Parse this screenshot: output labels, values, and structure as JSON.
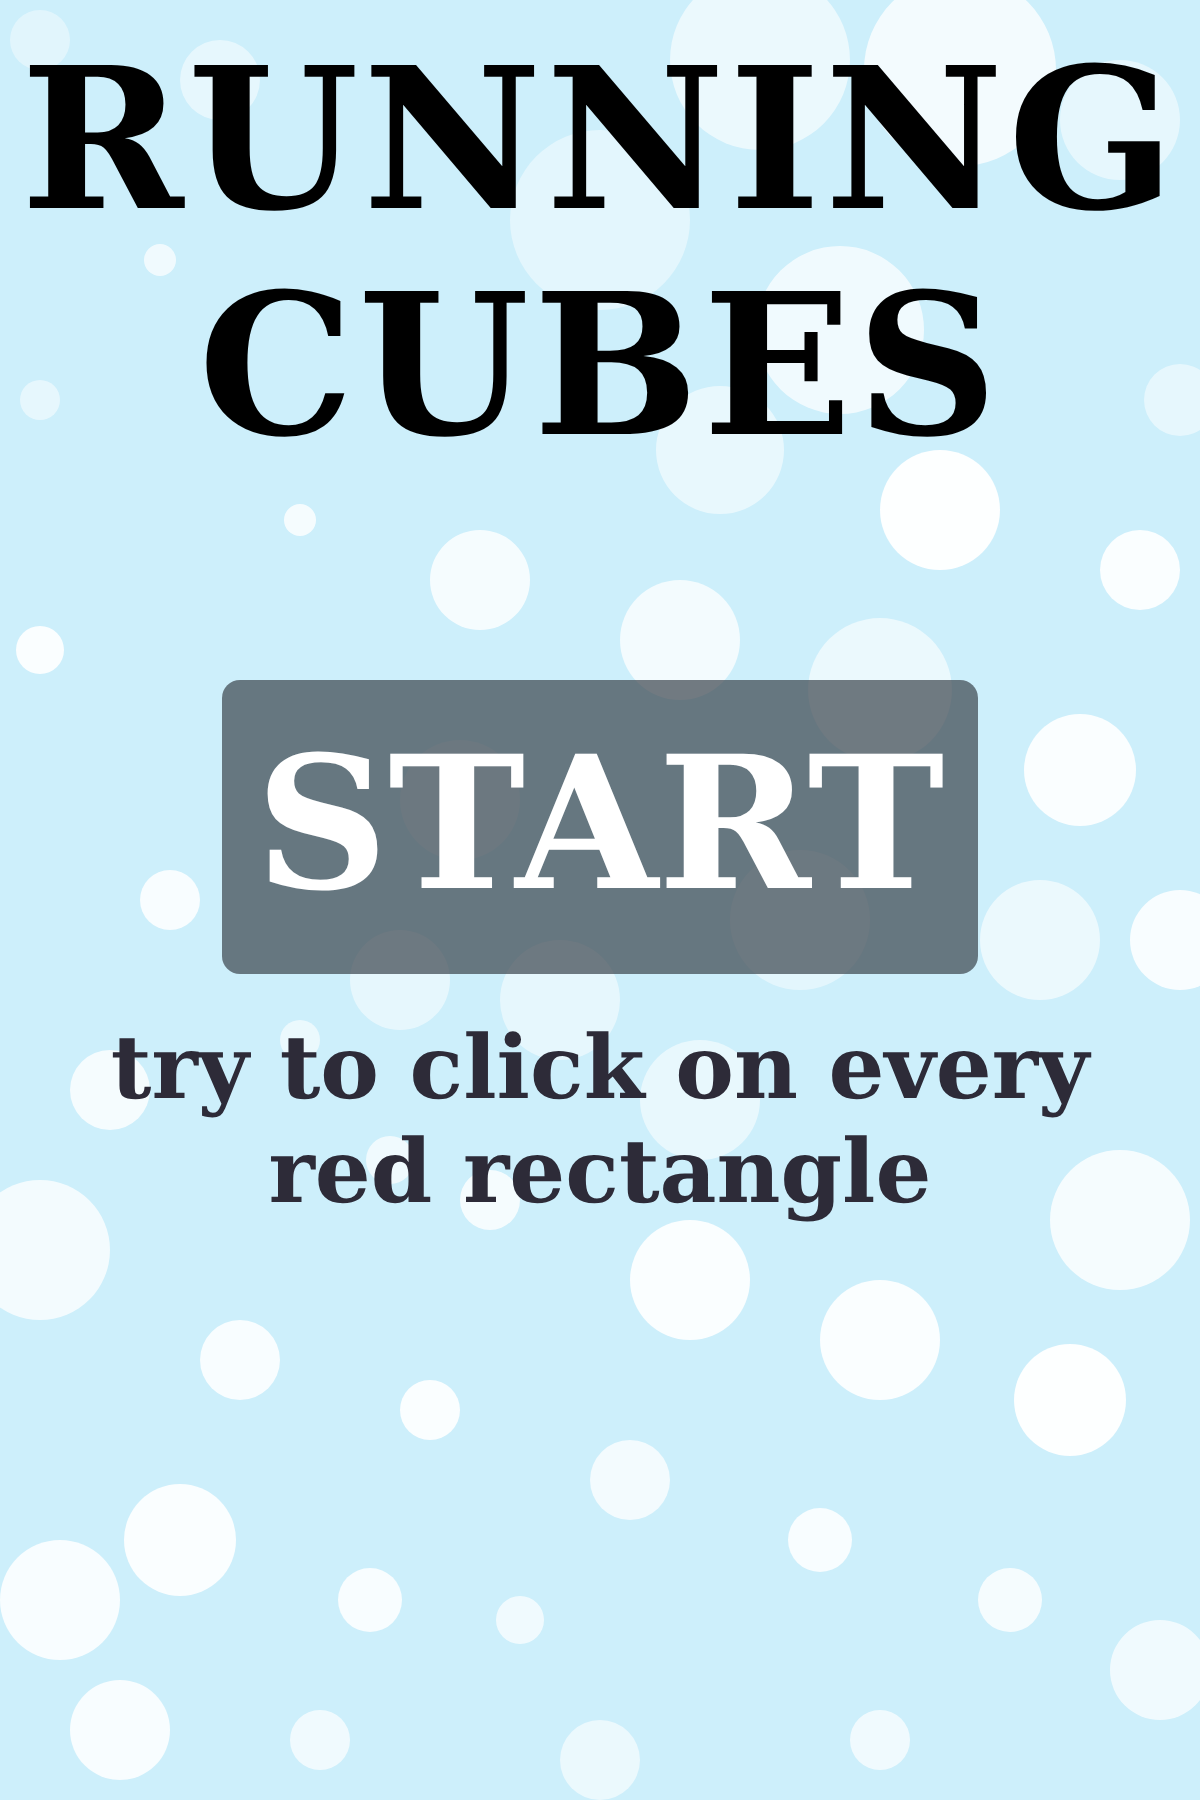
{
  "title": "RUNNING CUBES",
  "start_button": {
    "label": "START"
  },
  "hint": "try to click on every red rectangle"
}
